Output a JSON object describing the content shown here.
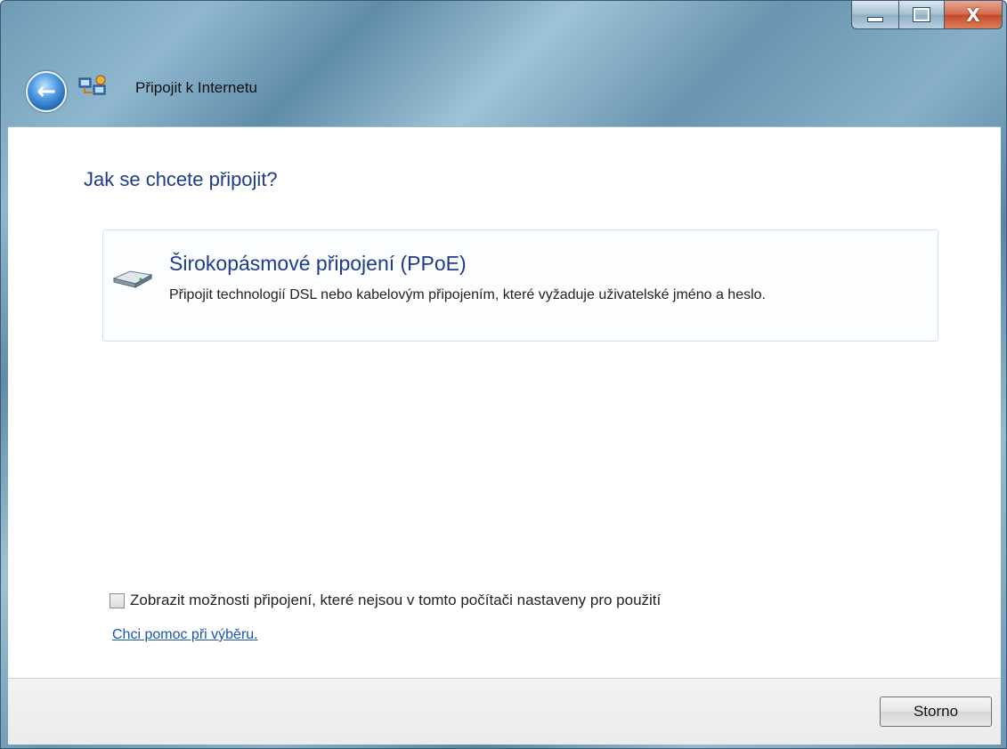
{
  "window": {
    "title": "Připojit k Internetu",
    "buttons": {
      "minimize": "minimize",
      "maximize": "maximize",
      "close": "X"
    }
  },
  "navigation": {
    "back_icon": "back-arrow-icon"
  },
  "main": {
    "heading": "Jak se chcete připojit?",
    "options": [
      {
        "icon": "broadband-modem-icon",
        "title": "Širokopásmové připojení (PPoE)",
        "description": "Připojit technologií DSL nebo kabelovým připojením, které vyžaduje uživatelské jméno a heslo."
      }
    ],
    "show_unconfigured_checkbox": {
      "label": "Zobrazit možnosti připojení, které nejsou v tomto počítači nastaveny pro použití",
      "checked": false
    },
    "help_link": "Chci pomoc při výběru."
  },
  "footer": {
    "cancel_label": "Storno"
  },
  "colors": {
    "heading": "#1e3c8c",
    "link": "#1a55b3",
    "frame": "#6f9bb6"
  }
}
